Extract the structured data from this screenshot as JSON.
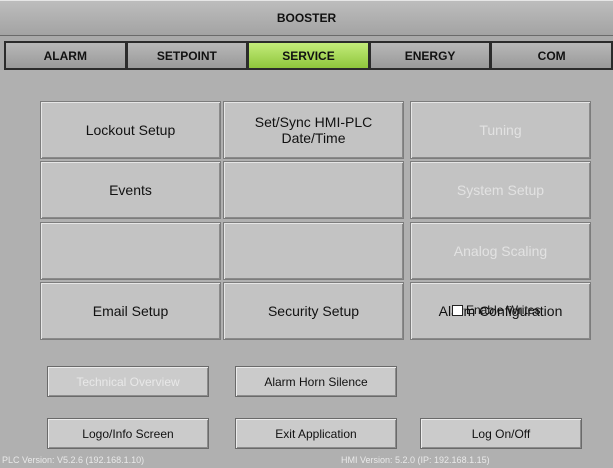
{
  "header": {
    "title": "BOOSTER"
  },
  "tabs": [
    {
      "label": "ALARM"
    },
    {
      "label": "SETPOINT"
    },
    {
      "label": "SERVICE",
      "active": true
    },
    {
      "label": "ENERGY"
    },
    {
      "label": "COM"
    }
  ],
  "grid": {
    "r1c1": "Lockout Setup",
    "r1c2": "Set/Sync HMI-PLC\nDate/Time",
    "r1c3": "Tuning",
    "r2c1": "Events",
    "r2c2": "",
    "r2c3": "System Setup",
    "r3c1": "",
    "r3c2": "",
    "r3c3": "Analog Scaling",
    "r4c1": "Email Setup",
    "r4c2": "Security Setup",
    "r4c3": "Alarm Configuration"
  },
  "actions": {
    "technical_overview": "Technical Overview",
    "alarm_horn_silence": "Alarm Horn Silence",
    "enable_writes": "Enable Writes",
    "logo_info": "Logo/Info Screen",
    "exit_app": "Exit Application",
    "log_on_off": "Log On/Off"
  },
  "footer": {
    "plc_version": "PLC Version: V5.2.6   (192.168.1.10)",
    "hmi_version": "HMI Version: 5.2.0 (IP: 192.168.1.15)"
  },
  "colors": {
    "active_tab": "#a6d957",
    "background": "#b0b0b0",
    "disabled_text": "#e2e2e2"
  }
}
